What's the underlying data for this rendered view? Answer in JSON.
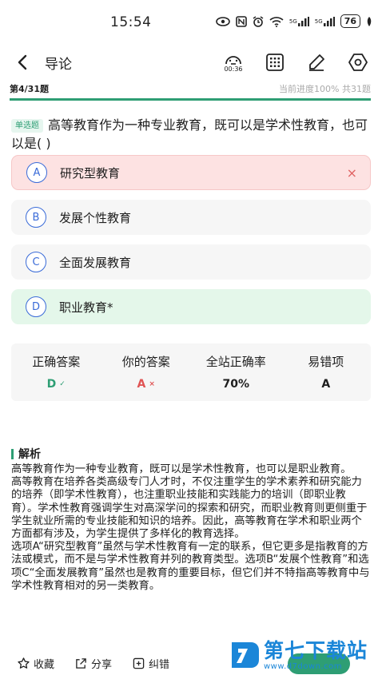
{
  "status_bar": {
    "time": "15:54",
    "signal_a": "5G",
    "signal_b": "5G",
    "battery": "76"
  },
  "nav": {
    "title": "导论",
    "timer": "00:36"
  },
  "progress": {
    "index": "第4/31题",
    "status": "当前进度100%  共31题",
    "fraction": 1.0
  },
  "question": {
    "type": "单选题",
    "text": "高等教育作为一种专业教育，既可以是学术性教育，也可以是(   )"
  },
  "options": [
    {
      "letter": "A",
      "text": "研究型教育",
      "state": "wrong",
      "mark": "×"
    },
    {
      "letter": "B",
      "text": "发展个性教育",
      "state": "normal",
      "mark": ""
    },
    {
      "letter": "C",
      "text": "全面发展教育",
      "state": "normal",
      "mark": ""
    },
    {
      "letter": "D",
      "text": "职业教育*",
      "state": "correct",
      "mark": ""
    }
  ],
  "stats": {
    "labels": [
      "正确答案",
      "你的答案",
      "全站正确率",
      "易错项"
    ],
    "correct_answer": "D",
    "your_answer": "A",
    "accuracy": "70%",
    "error_prone": "A",
    "check_mark": "✓",
    "cross_mark": "×"
  },
  "analysis": {
    "title": "解析",
    "paragraphs": [
      "高等教育作为一种专业教育，既可以是学术性教育，也可以是职业教育。",
      "高等教育在培养各类高级专门人才时，不仅注重学生的学术素养和研究能力的培养（即学术性教育），也注重职业技能和实践能力的培训（即职业教育）。学术性教育强调学生对高深学问的探索和研究，而职业教育则更侧重于学生就业所需的专业技能和知识的培养。因此，高等教育在学术和职业两个方面都有涉及，为学生提供了多样化的教育选择。",
      "选项A“研究型教育”虽然与学术性教育有一定的联系，但它更多是指教育的方法或模式，而不是与学术性教育并列的教育类型。选项B“发展个性教育”和选项C“全面发展教育”虽然也是教育的重要目标，但它们并不特指高等教育中与学术性教育相对的另一类教育。"
    ]
  },
  "bottom": {
    "collect": "收藏",
    "share": "分享",
    "report": "纠错"
  },
  "watermark": {
    "name": "第七下载站",
    "url": "www.d7down.com"
  },
  "colors": {
    "accent": "#2e9e74",
    "wrong": "#e05454",
    "option_letter": "#3a6bd8",
    "watermark": "#1b86d8"
  }
}
